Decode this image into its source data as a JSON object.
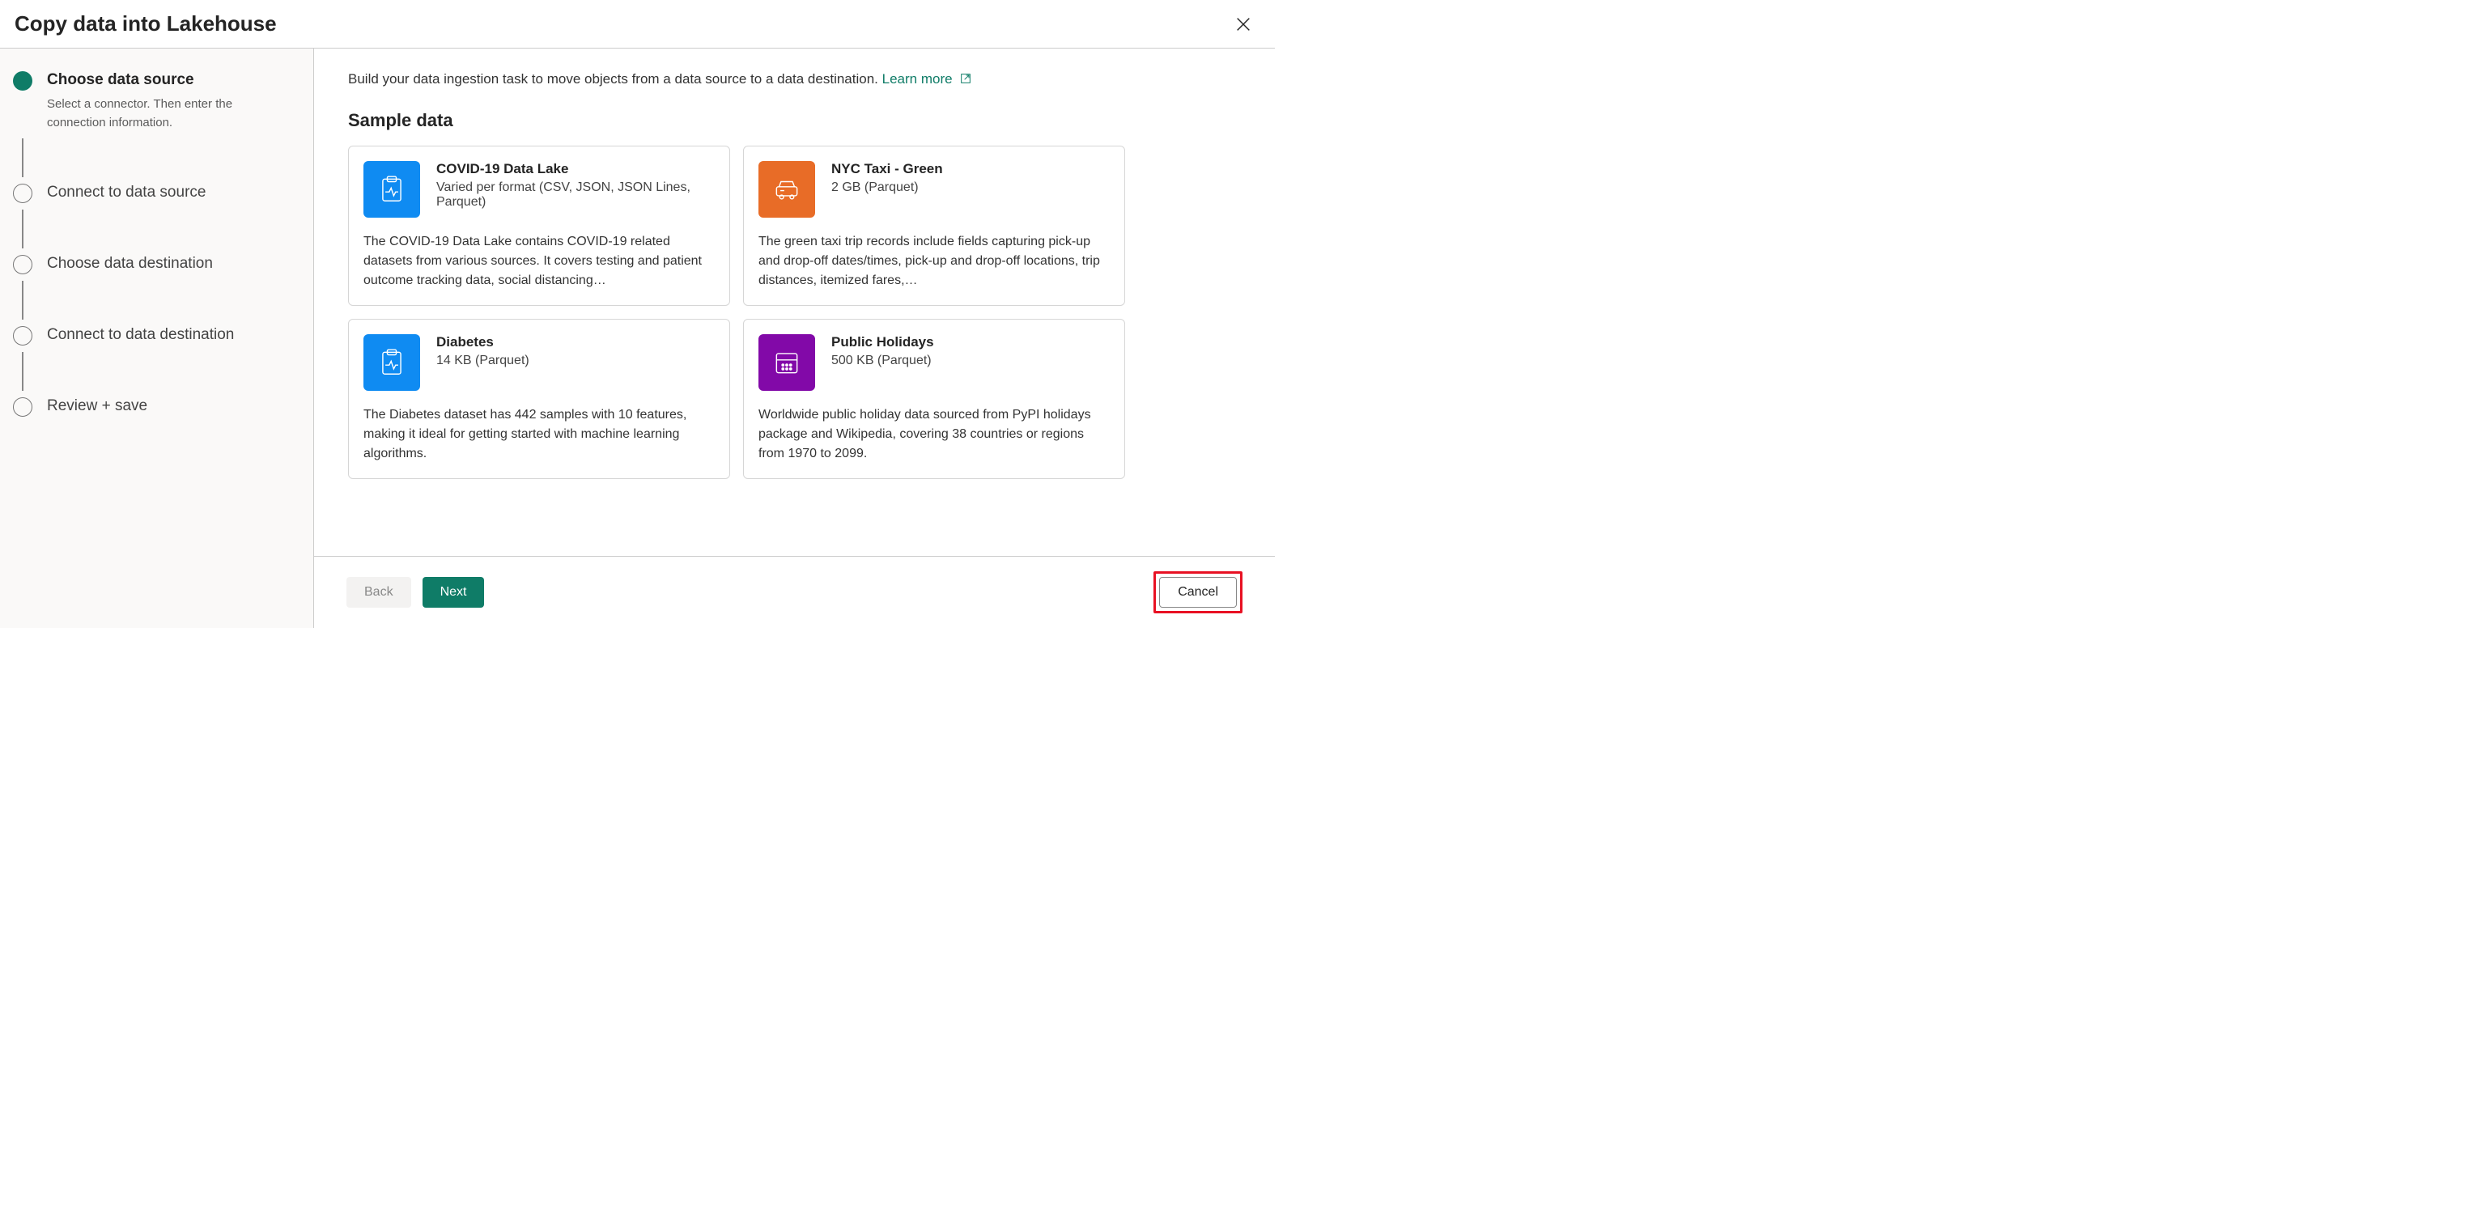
{
  "header": {
    "title": "Copy data into Lakehouse"
  },
  "sidebar": {
    "steps": [
      {
        "label": "Choose data source",
        "desc": "Select a connector. Then enter the connection information."
      },
      {
        "label": "Connect to data source"
      },
      {
        "label": "Choose data destination"
      },
      {
        "label": "Connect to data destination"
      },
      {
        "label": "Review + save"
      }
    ]
  },
  "main": {
    "intro": "Build your data ingestion task to move objects from a data source to a data destination.",
    "learn_more": "Learn more",
    "section_title": "Sample data",
    "cards": [
      {
        "title": "COVID-19 Data Lake",
        "sub": "Varied per format (CSV, JSON, JSON Lines, Parquet)",
        "desc": "The COVID-19 Data Lake contains COVID-19 related datasets from various sources. It covers testing and patient outcome tracking data, social distancing…"
      },
      {
        "title": "NYC Taxi - Green",
        "sub": "2 GB (Parquet)",
        "desc": "The green taxi trip records include fields capturing pick-up and drop-off dates/times, pick-up and drop-off locations, trip distances, itemized fares,…"
      },
      {
        "title": "Diabetes",
        "sub": "14 KB (Parquet)",
        "desc": "The Diabetes dataset has 442 samples with 10 features, making it ideal for getting started with machine learning algorithms."
      },
      {
        "title": "Public Holidays",
        "sub": "500 KB (Parquet)",
        "desc": "Worldwide public holiday data sourced from PyPI holidays package and Wikipedia, covering 38 countries or regions from 1970 to 2099."
      }
    ]
  },
  "footer": {
    "back": "Back",
    "next": "Next",
    "cancel": "Cancel"
  }
}
